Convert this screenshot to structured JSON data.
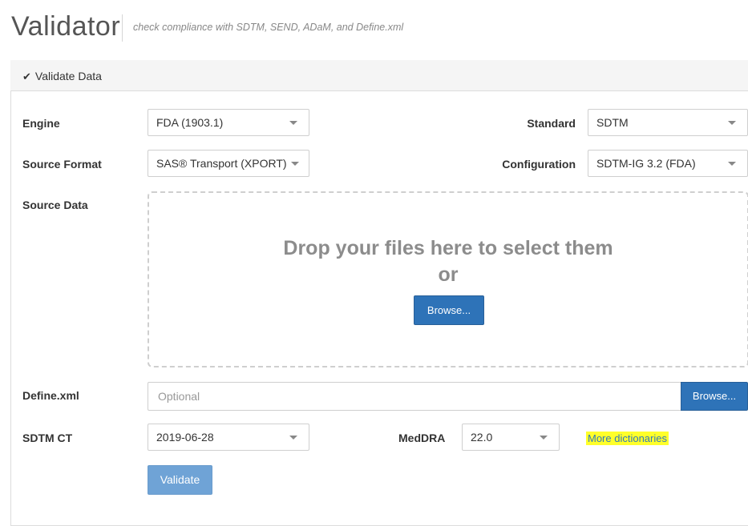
{
  "header": {
    "title": "Validator",
    "subtitle": "check compliance with SDTM, SEND, ADaM, and Define.xml"
  },
  "panel": {
    "title": "Validate Data"
  },
  "form": {
    "engine": {
      "label": "Engine",
      "value": "FDA (1903.1)"
    },
    "standard": {
      "label": "Standard",
      "value": "SDTM"
    },
    "source_format": {
      "label": "Source Format",
      "value": "SAS® Transport (XPORT)"
    },
    "configuration": {
      "label": "Configuration",
      "value": "SDTM-IG 3.2 (FDA)"
    },
    "source_data": {
      "label": "Source Data",
      "drop_text": "Drop your files here to select them",
      "or_text": "or",
      "browse_label": "Browse..."
    },
    "define_xml": {
      "label": "Define.xml",
      "placeholder": "Optional",
      "browse_label": "Browse..."
    },
    "sdtm_ct": {
      "label": "SDTM CT",
      "value": "2019-06-28"
    },
    "meddra": {
      "label": "MedDRA",
      "value": "22.0"
    },
    "more_dictionaries": "More dictionaries",
    "validate_label": "Validate"
  },
  "colors": {
    "primary": "#2e73b8",
    "primary_disabled": "#6fa3d6",
    "highlight": "#ffff2a"
  }
}
